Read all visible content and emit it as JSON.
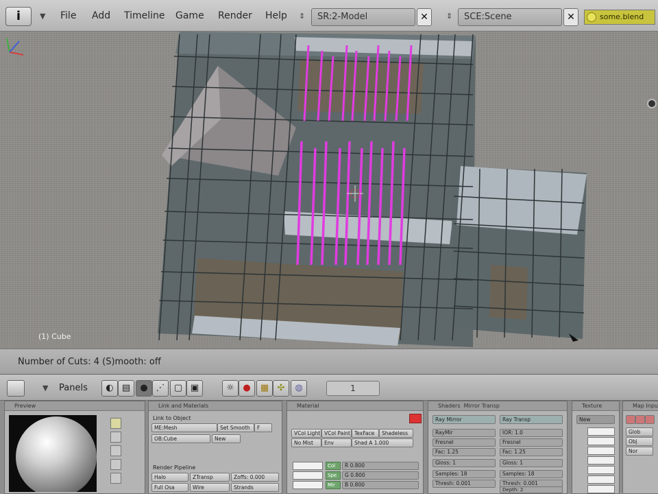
{
  "header": {
    "editor_icon": "i",
    "menus": [
      "File",
      "Add",
      "Timeline",
      "Game",
      "Render",
      "Help"
    ],
    "screen_field": "SR:2-Model",
    "scene_field": "SCE:Scene",
    "close_glyph": "✕",
    "file_badge": "some.blend"
  },
  "viewport": {
    "object_label": "(1) Cube",
    "colors": {
      "wall": "#5f6a6e",
      "wall_dark": "#4b5558",
      "roof": "#8b8688",
      "light_edge": "#b3bcc2",
      "floor_panel": "#6b6254",
      "selected": "#e03ce0"
    }
  },
  "status": {
    "text": "Number of Cuts: 4 (S)mooth: off"
  },
  "buttons_header": {
    "panels_label": "Panels",
    "frame_number": "1"
  },
  "panels": {
    "preview": {
      "title": "Preview"
    },
    "link": {
      "title": "Link and Materials",
      "link_to_object": "Link to Object",
      "me_field": "ME:Mesh",
      "ob_field": "OB:Cube",
      "f_label": "F",
      "new_btn": "New",
      "set_smooth": "Set Smooth",
      "render_pipeline": "Render Pipeline",
      "halo": "Halo",
      "ztransp": "ZTransp",
      "zoffs": "Zoffs: 0.000",
      "full_osa": "Full Osa",
      "wire": "Wire",
      "strands": "Strands"
    },
    "material": {
      "title": "Material",
      "row1": [
        "VCol Light",
        "VCol Paint",
        "TexFace",
        "Shadeless"
      ],
      "row2": [
        "No Mist",
        "Env",
        "Shad A 1.000"
      ],
      "col_labels": [
        "Col",
        "Spe",
        "Mir"
      ],
      "values": [
        "R 0.800",
        "G 0.800",
        "B 0.800"
      ]
    },
    "shaders": {
      "title": "Shaders",
      "mirror_tab": "Mirror Transp",
      "ray_mirror": "Ray Mirror",
      "ray_transp": "Ray Transp",
      "left": [
        "RayMir",
        "Fresnel",
        "Fac: 1.25",
        "Gloss: 1",
        "Samples: 18",
        "Thresh: 0.001"
      ],
      "right": [
        "IOR: 1.0",
        "Fresnel",
        "Fac: 1.25",
        "Gloss: 1",
        "Samples: 18",
        "Thresh: 0.001",
        "Depth: 2"
      ]
    },
    "texture": {
      "title": "Texture",
      "new_btn": "New"
    },
    "mapping": {
      "title": "Map Input",
      "labels": [
        "Glob",
        "Obj",
        "Nor"
      ]
    }
  }
}
